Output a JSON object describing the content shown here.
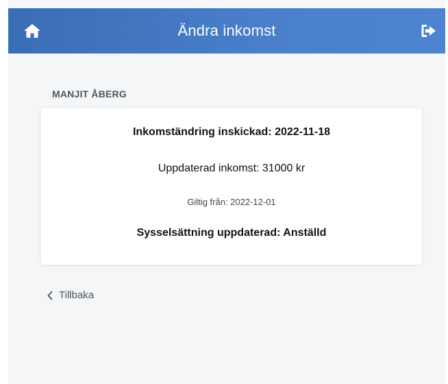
{
  "header": {
    "title": "Ändra inkomst",
    "home_icon": "home-icon",
    "logout_icon": "logout-icon"
  },
  "person": {
    "name": "MANJIT ÅBERG"
  },
  "card": {
    "submitted": "Inkomständring inskickad: 2022-11-18",
    "updated_income": "Uppdaterad inkomst: 31000 kr",
    "valid_from": "Giltig från: 2022-12-01",
    "employment": "Sysselsättning uppdaterad: Anställd"
  },
  "back": {
    "label": "Tillbaka",
    "icon": "chevron-left-icon"
  },
  "colors": {
    "header": "#4a7fcb",
    "background": "#f5f6f7",
    "card": "#ffffff"
  }
}
